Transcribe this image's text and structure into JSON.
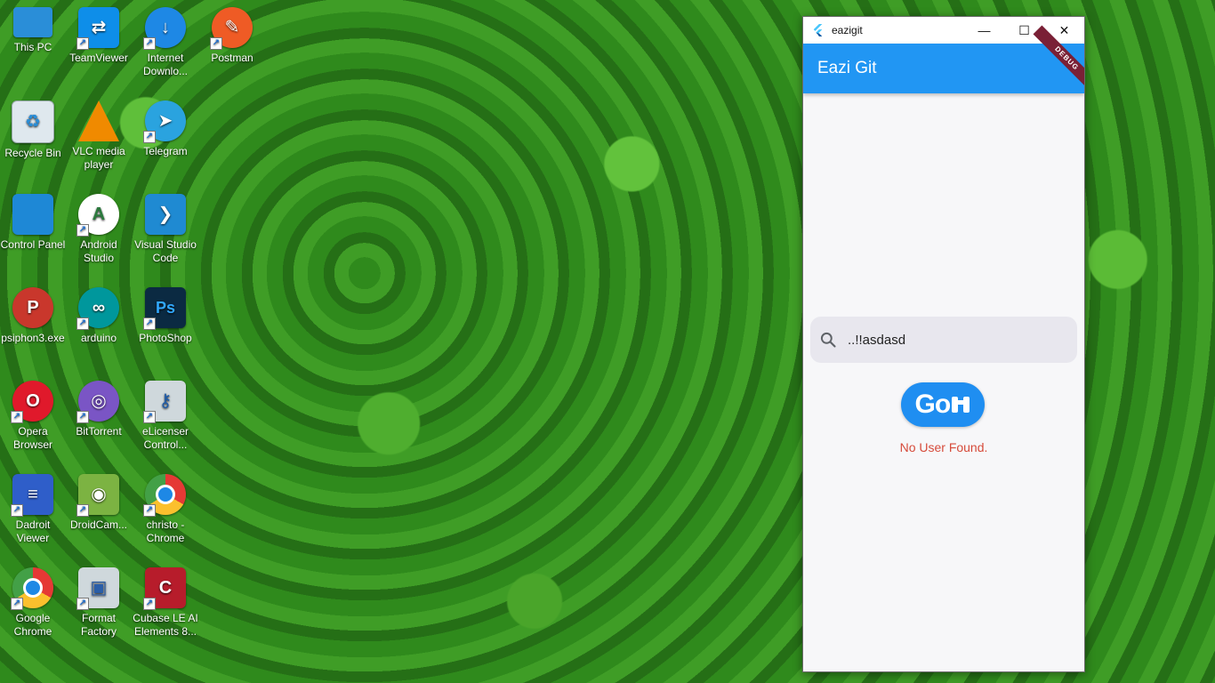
{
  "desktop": {
    "icons": [
      {
        "label": "This PC",
        "icon": "computer-icon"
      },
      {
        "label": "TeamViewer",
        "icon": "teamviewer-icon"
      },
      {
        "label": "Internet Downlo...",
        "icon": "internet-download-manager-icon"
      },
      {
        "label": "Postman",
        "icon": "postman-icon"
      },
      {
        "label": "Recycle Bin",
        "icon": "recycle-bin-icon"
      },
      {
        "label": "VLC media player",
        "icon": "vlc-icon"
      },
      {
        "label": "Telegram",
        "icon": "telegram-icon"
      },
      {
        "label": "Control Panel",
        "icon": "control-panel-icon"
      },
      {
        "label": "Android Studio",
        "icon": "android-studio-icon"
      },
      {
        "label": "Visual Studio Code",
        "icon": "vscode-icon"
      },
      {
        "label": "psiphon3.exe",
        "icon": "psiphon-icon"
      },
      {
        "label": "arduino",
        "icon": "arduino-icon"
      },
      {
        "label": "PhotoShop",
        "icon": "photoshop-icon"
      },
      {
        "label": "Opera Browser",
        "icon": "opera-icon"
      },
      {
        "label": "BitTorrent",
        "icon": "bittorrent-icon"
      },
      {
        "label": "eLicenser Control...",
        "icon": "elicenser-icon"
      },
      {
        "label": "Dadroit Viewer",
        "icon": "dadroit-icon"
      },
      {
        "label": "DroidCam...",
        "icon": "droidcam-icon"
      },
      {
        "label": "christo - Chrome",
        "icon": "chrome-profile-icon"
      },
      {
        "label": "Google Chrome",
        "icon": "chrome-icon"
      },
      {
        "label": "Format Factory",
        "icon": "format-factory-icon"
      },
      {
        "label": "Cubase LE AI Elements 8...",
        "icon": "cubase-icon"
      }
    ]
  },
  "window": {
    "title": "eazigit",
    "minimize": "—",
    "maximize": "☐",
    "close": "✕",
    "appbar_title": "Eazi Git",
    "debug_banner": "DEBUG",
    "search_value": "..!!asdasd",
    "go_label": "Go ",
    "error": "No User Found."
  },
  "colors": {
    "appbar": "#2196f3",
    "go_button": "#1f8ef1",
    "error": "#d64b3b"
  }
}
